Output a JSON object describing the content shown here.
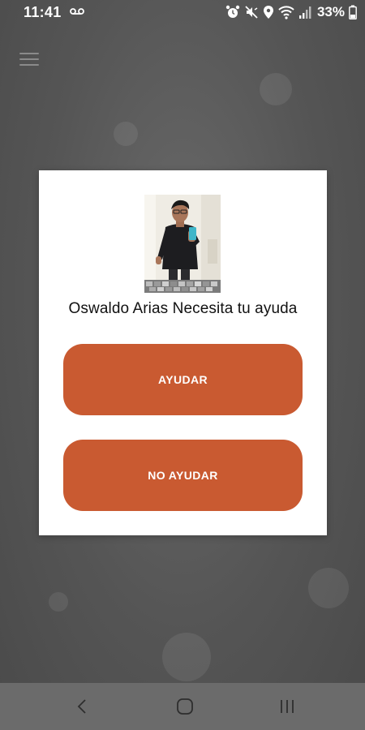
{
  "status_bar": {
    "time": "11:41",
    "battery": "33%",
    "icons": [
      "voicemail-icon",
      "alarm-icon",
      "mute-icon",
      "location-icon",
      "wifi-icon",
      "signal-icon",
      "battery-icon"
    ]
  },
  "app_bar": {
    "menu_icon": "hamburger-menu-icon"
  },
  "dialog": {
    "avatar_icon": "profile-photo",
    "title": "Oswaldo Arias Necesita tu ayuda",
    "help_button_label": "AYUDAR",
    "no_help_button_label": "NO AYUDAR",
    "button_color": "#c95a31"
  },
  "nav_bar": {
    "back_icon": "back-icon",
    "home_icon": "home-icon",
    "recents_icon": "recents-icon"
  }
}
